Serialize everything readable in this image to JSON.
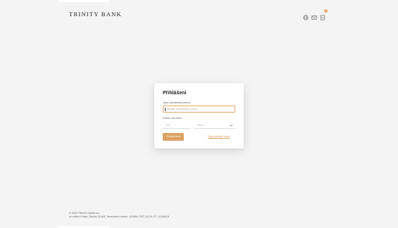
{
  "header": {
    "logo": "TRINITY BANK",
    "icons": [
      "globe-icon",
      "mail-icon",
      "document-icon"
    ],
    "notification_count": "0"
  },
  "login": {
    "title": "Přihlášení",
    "user_label": "Vaše uživatelské jméno",
    "user_placeholder": "Zadejte uživatelské jméno",
    "dob_label": "Datum narození",
    "day_placeholder": "Den",
    "month_placeholder": "Měsíc",
    "submit_label": "Pokračovat",
    "forgot_label": "Zapomenuté heslo"
  },
  "footer": {
    "line1": "© 2020 TRINITY BANK a.s.",
    "line2": "se sídlem Praha, Dlouhá 1234/5, Termination vlastní: 123456, PSČ 110 00, IČ: 12345678"
  },
  "colors": {
    "accent": "#dca163",
    "background": "#f4f4f4"
  }
}
